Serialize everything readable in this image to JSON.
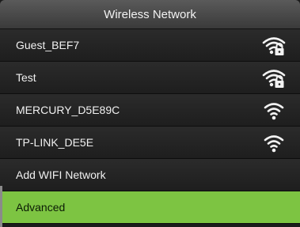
{
  "header": {
    "title": "Wireless Network"
  },
  "networks": [
    {
      "label": "Guest_BEF7",
      "icon": "wifi-locked-icon"
    },
    {
      "label": "Test",
      "icon": "wifi-locked-icon"
    },
    {
      "label": "MERCURY_D5E89C",
      "icon": "wifi-icon"
    },
    {
      "label": "TP-LINK_DE5E",
      "icon": "wifi-icon"
    }
  ],
  "actions": {
    "add_wifi": "Add WIFI Network",
    "advanced": "Advanced"
  },
  "colors": {
    "selected": "#7dc442",
    "title_bar": "#4a4a4a"
  }
}
